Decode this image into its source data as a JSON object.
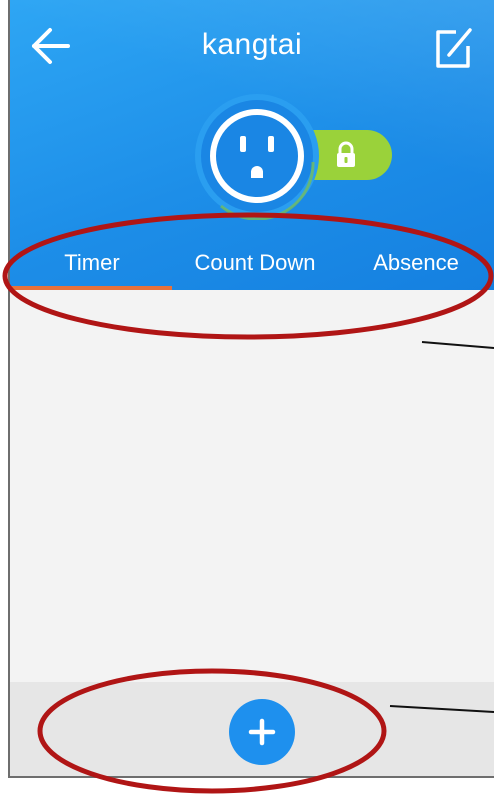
{
  "header": {
    "title": "kangtai",
    "back_icon": "arrow-left-icon",
    "edit_icon": "edit-icon",
    "background_color": "#1d8ee8"
  },
  "device": {
    "outlet_icon": "power-outlet-icon",
    "lock_icon": "lock-icon",
    "lock_color": "#9ad23a"
  },
  "tabs": [
    {
      "label": "Timer",
      "active": true
    },
    {
      "label": "Count Down",
      "active": false
    },
    {
      "label": "Absence",
      "active": false
    }
  ],
  "active_tab_color": "#e8713a",
  "bottom": {
    "add_icon": "plus-icon",
    "add_color": "#1e90ee"
  },
  "annotations": {
    "highlight_color": "#b01515"
  }
}
